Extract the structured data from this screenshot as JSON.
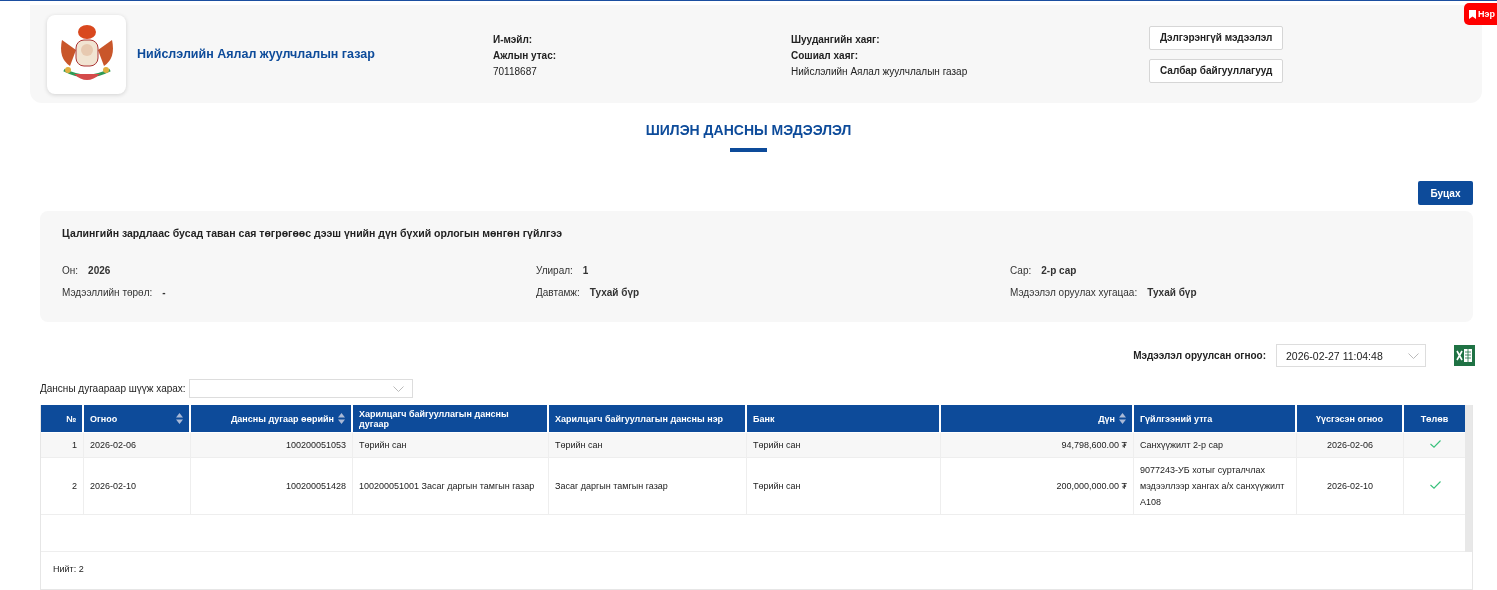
{
  "org": {
    "name": "Нийслэлийн Аялал жуулчлалын газар",
    "email_label": "И-мэйл:",
    "phone_label": "Ажлын утас:",
    "phone": "70118687",
    "address_label": "Шуудангийн хаяг:",
    "social_label": "Сошиал хаяг:",
    "social": "Нийслэлийн Аялал жуулчлалын газар",
    "buttons": [
      "Дэлгэрэнгүй мэдээлэл",
      "Салбар байгууллагууд"
    ]
  },
  "corner_tab": "Нэр",
  "page_title": "ШИЛЭН ДАНСНЫ МЭДЭЭЛЭЛ",
  "back_button": "Буцах",
  "report": {
    "title": "Цалингийн зардлаас бусад таван сая төгрөгөөс дээш үнийн дүн бүхий орлогын мөнгөн гүйлгээ",
    "fields": [
      {
        "label": "Он:",
        "value": "2026"
      },
      {
        "label": "Улирал:",
        "value": "1"
      },
      {
        "label": "Сар:",
        "value": "2-р сар"
      },
      {
        "label": "Мэдээллийн төрөл:",
        "value": "-"
      },
      {
        "label": "Давтамж:",
        "value": "Тухай бүр"
      },
      {
        "label": "Мэдээлэл оруулах хугацаа:",
        "value": "Тухай бүр"
      }
    ]
  },
  "submitted": {
    "label": "Мэдээлэл оруулсан огноо:",
    "value": "2026-02-27 11:04:48"
  },
  "filter": {
    "label": "Дансны дугаараар шүүж харах:"
  },
  "table": {
    "columns": [
      {
        "label": "№",
        "sortable": false
      },
      {
        "label": "Огноо",
        "sortable": true
      },
      {
        "label": "Дансны дугаар өөрийн",
        "sortable": true
      },
      {
        "label": "Харилцагч байгууллагын дансны дугаар",
        "sortable": false
      },
      {
        "label": "Харилцагч байгууллагын дансны нэр",
        "sortable": false
      },
      {
        "label": "Банк",
        "sortable": false
      },
      {
        "label": "Дүн",
        "sortable": true
      },
      {
        "label": "Гүйлгээний утга",
        "sortable": false
      },
      {
        "label": "Үүсгэсэн огноо",
        "sortable": false
      },
      {
        "label": "Төлөв",
        "sortable": false
      }
    ],
    "rows": [
      {
        "cells": [
          "1",
          "2026-02-06",
          "100200051053",
          "Төрийн сан",
          "Төрийн сан",
          "Төрийн сан",
          "94,798,600.00 ₮",
          "Санхүүжилт 2-р сар",
          "2026-02-06"
        ],
        "paid": true
      },
      {
        "cells": [
          "2",
          "2026-02-10",
          "100200051428",
          "100200051001 Засаг даргын тамгын газар",
          "Засаг даргын тамгын газар",
          "Төрийн сан",
          "200,000,000.00 ₮",
          "9077243-УБ хотыг сурталчлах мэдээллээр хангах а/х санхүүжилт А108",
          "2026-02-10"
        ],
        "paid": true
      }
    ],
    "total": "Нийт: 2"
  }
}
